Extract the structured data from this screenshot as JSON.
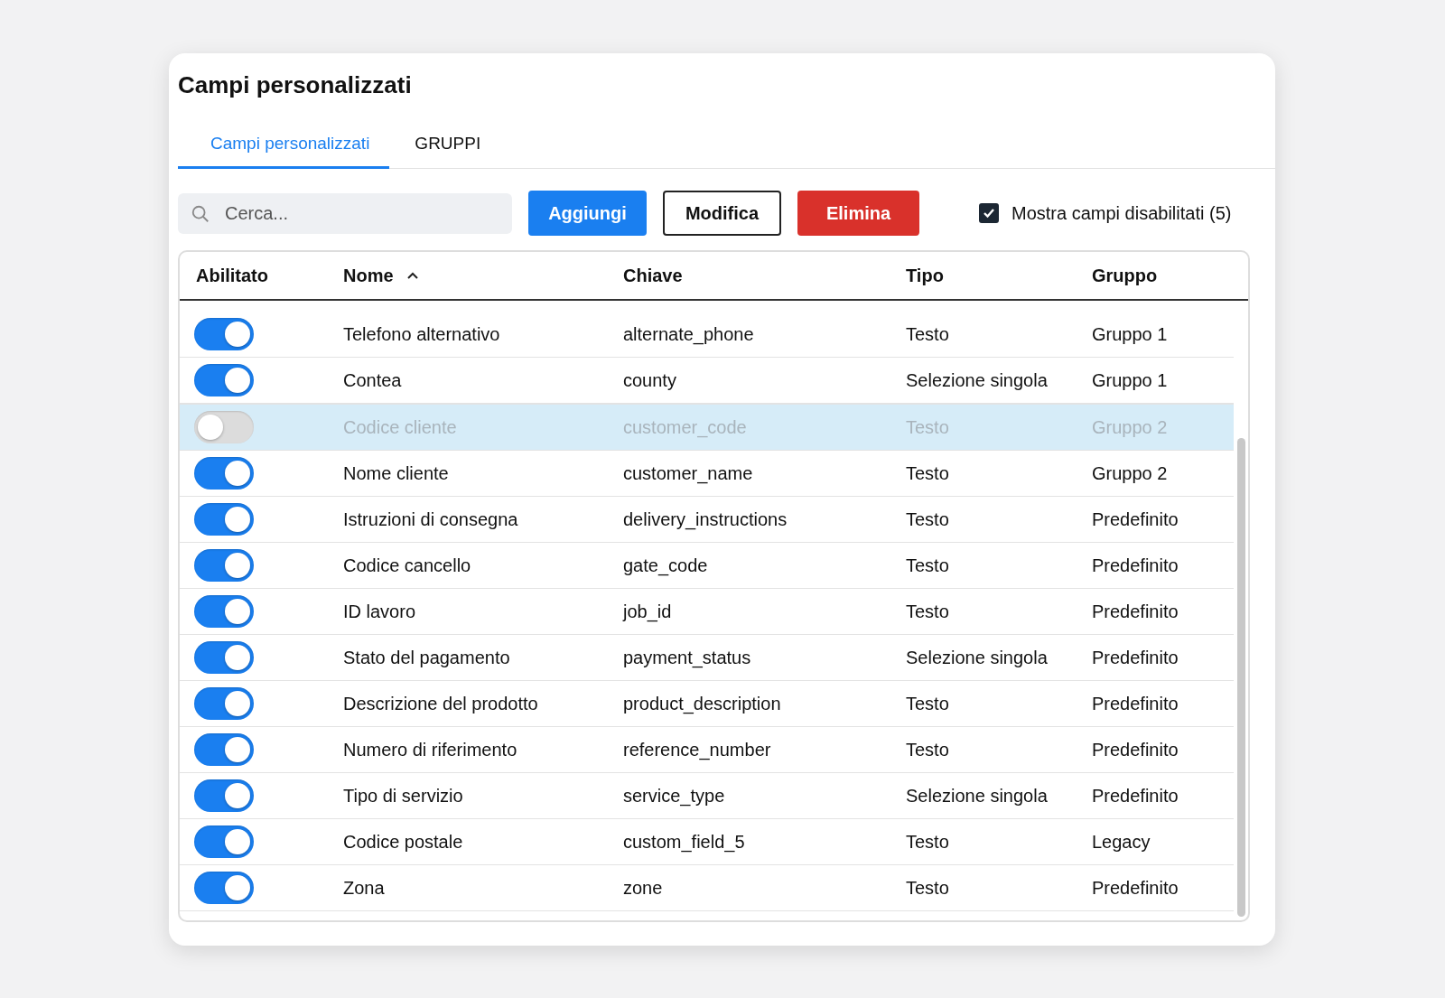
{
  "title": "Campi personalizzati",
  "tabs": [
    {
      "label": "Campi personalizzati",
      "selected": true
    },
    {
      "label": "GRUPPI",
      "selected": false
    }
  ],
  "search": {
    "placeholder": "Cerca..."
  },
  "buttons": [
    {
      "label": "Aggiungi",
      "kind": "primary"
    },
    {
      "label": "Modifica",
      "kind": "outline"
    },
    {
      "label": "Elimina",
      "kind": "danger"
    }
  ],
  "show_disabled": {
    "label": "Mostra campi disabilitati (5)",
    "checked": true
  },
  "table": {
    "columns": [
      {
        "label": "Abilitato",
        "sorted": false
      },
      {
        "label": "Nome",
        "sorted": true
      },
      {
        "label": "Chiave",
        "sorted": false
      },
      {
        "label": "Tipo",
        "sorted": false
      },
      {
        "label": "Gruppo",
        "sorted": false
      }
    ],
    "rows": [
      {
        "selected": false,
        "cells": [
          {
            "kind": "toggle",
            "on": true
          },
          "Telefono alternativo",
          "alternate_phone",
          "Testo",
          "Gruppo 1"
        ]
      },
      {
        "selected": false,
        "cells": [
          {
            "kind": "toggle",
            "on": true
          },
          "Contea",
          "county",
          "Selezione singola",
          "Gruppo 1"
        ]
      },
      {
        "selected": true,
        "cells": [
          {
            "kind": "toggle",
            "on": false
          },
          "Codice cliente",
          "customer_code",
          "Testo",
          "Gruppo 2"
        ]
      },
      {
        "selected": false,
        "cells": [
          {
            "kind": "toggle",
            "on": true
          },
          "Nome cliente",
          "customer_name",
          "Testo",
          "Gruppo 2"
        ]
      },
      {
        "selected": false,
        "cells": [
          {
            "kind": "toggle",
            "on": true
          },
          "Istruzioni di consegna",
          "delivery_instructions",
          "Testo",
          "Predefinito"
        ]
      },
      {
        "selected": false,
        "cells": [
          {
            "kind": "toggle",
            "on": true
          },
          "Codice cancello",
          "gate_code",
          "Testo",
          "Predefinito"
        ]
      },
      {
        "selected": false,
        "cells": [
          {
            "kind": "toggle",
            "on": true
          },
          "ID lavoro",
          "job_id",
          "Testo",
          "Predefinito"
        ]
      },
      {
        "selected": false,
        "cells": [
          {
            "kind": "toggle",
            "on": true
          },
          "Stato del pagamento",
          "payment_status",
          "Selezione singola",
          "Predefinito"
        ]
      },
      {
        "selected": false,
        "cells": [
          {
            "kind": "toggle",
            "on": true
          },
          "Descrizione del prodotto",
          "product_description",
          "Testo",
          "Predefinito"
        ]
      },
      {
        "selected": false,
        "cells": [
          {
            "kind": "toggle",
            "on": true
          },
          "Numero di riferimento",
          "reference_number",
          "Testo",
          "Predefinito"
        ]
      },
      {
        "selected": false,
        "cells": [
          {
            "kind": "toggle",
            "on": true
          },
          "Tipo di servizio",
          "service_type",
          "Selezione singola",
          "Predefinito"
        ]
      },
      {
        "selected": false,
        "cells": [
          {
            "kind": "toggle",
            "on": true
          },
          "Codice postale",
          "custom_field_5",
          "Testo",
          "Legacy"
        ]
      },
      {
        "selected": false,
        "cells": [
          {
            "kind": "toggle",
            "on": true
          },
          "Zona",
          "zone",
          "Testo",
          "Predefinito"
        ]
      }
    ]
  }
}
